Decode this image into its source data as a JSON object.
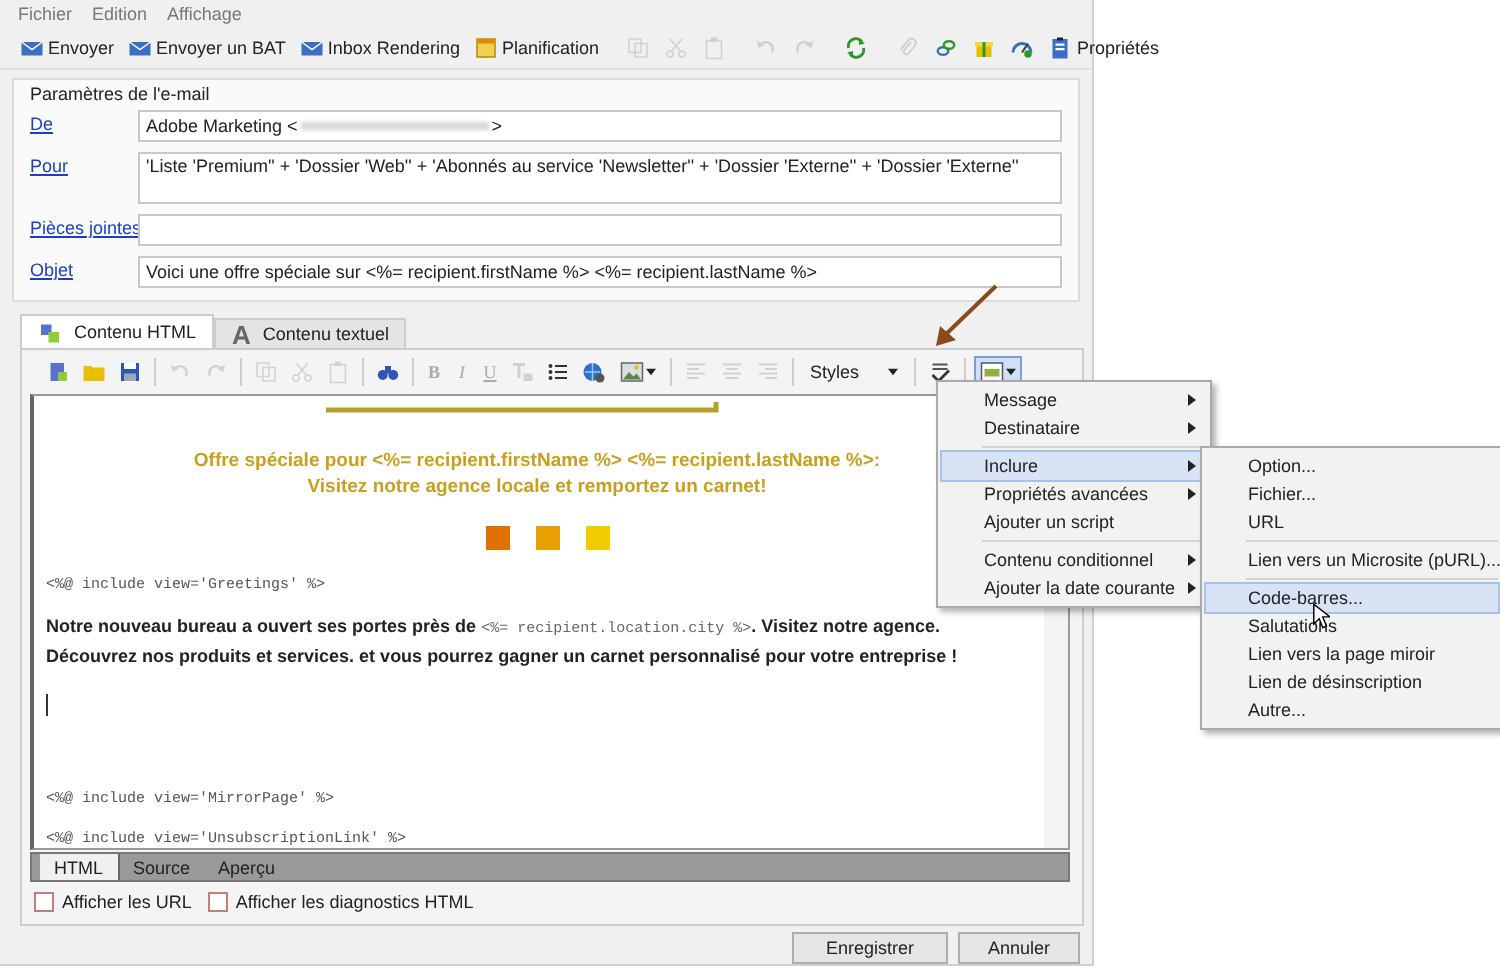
{
  "menu_bar": [
    {
      "label": "Fichier"
    },
    {
      "label": "Edition"
    },
    {
      "label": "Affichage"
    }
  ],
  "toolbar": [
    {
      "kind": "button",
      "label": "Envoyer",
      "disabled": false
    },
    {
      "kind": "button",
      "label": "Envoyer un BAT",
      "disabled": false
    },
    {
      "kind": "button",
      "label": "Inbox Rendering",
      "disabled": false
    },
    {
      "kind": "button",
      "label": "Planification",
      "disabled": false
    },
    {
      "kind": "separator"
    },
    {
      "kind": "icon",
      "disabled": true
    },
    {
      "kind": "icon",
      "disabled": true
    },
    {
      "kind": "icon",
      "disabled": true
    },
    {
      "kind": "separator"
    },
    {
      "kind": "icon",
      "disabled": true
    },
    {
      "kind": "icon",
      "disabled": true
    },
    {
      "kind": "separator"
    },
    {
      "kind": "icon",
      "disabled": false
    },
    {
      "kind": "separator"
    },
    {
      "kind": "icon",
      "disabled": true
    },
    {
      "kind": "icon",
      "disabled": false
    },
    {
      "kind": "icon",
      "disabled": false
    },
    {
      "kind": "icon",
      "disabled": false
    },
    {
      "kind": "button",
      "label": "Propriétés",
      "disabled": false
    }
  ],
  "email_params": {
    "title": "Paramètres de l'e-mail",
    "fields": [
      {
        "kind": "single",
        "label": "De",
        "value": "Adobe Marketing <",
        "value_end": ">"
      },
      {
        "kind": "multi",
        "label": "Pour",
        "value": "'Liste 'Premium'' + 'Dossier 'Web'' + 'Abonnés au service 'Newsletter'' + 'Dossier 'Externe'' + 'Dossier 'Externe''"
      },
      {
        "kind": "single",
        "label": "Pièces jointes"
      },
      {
        "kind": "single",
        "label": "Objet",
        "value": "Voici une offre spéciale sur <%= recipient.firstName %> <%= recipient.lastName %>"
      }
    ]
  },
  "content_tabs": [
    {
      "label": "Contenu HTML",
      "selected": true
    },
    {
      "label": "Contenu textuel",
      "glyph": "A",
      "selected": false
    }
  ],
  "editor_toolbar": [
    {
      "kind": "icon",
      "disabled": false
    },
    {
      "kind": "icon",
      "disabled": false
    },
    {
      "kind": "icon",
      "disabled": false
    },
    {
      "kind": "separator"
    },
    {
      "kind": "icon",
      "disabled": true
    },
    {
      "kind": "icon",
      "disabled": true
    },
    {
      "kind": "separator"
    },
    {
      "kind": "icon",
      "disabled": true
    },
    {
      "kind": "icon",
      "disabled": true
    },
    {
      "kind": "icon",
      "disabled": true
    },
    {
      "kind": "separator"
    },
    {
      "kind": "icon",
      "disabled": false
    },
    {
      "kind": "separator"
    },
    {
      "kind": "letter",
      "label": "B",
      "disabled": true
    },
    {
      "kind": "letter",
      "label": "I",
      "disabled": true
    },
    {
      "kind": "letter",
      "label": "U",
      "disabled": true
    },
    {
      "kind": "icon",
      "disabled": true
    },
    {
      "kind": "icon",
      "disabled": false
    },
    {
      "kind": "icon",
      "disabled": false
    },
    {
      "kind": "dropdown",
      "disabled": false,
      "pressed": false
    },
    {
      "kind": "separator"
    },
    {
      "kind": "icon",
      "disabled": true
    },
    {
      "kind": "icon",
      "disabled": true
    },
    {
      "kind": "icon",
      "disabled": true
    },
    {
      "kind": "separator"
    },
    {
      "kind": "select",
      "label": "Styles",
      "disabled": false
    },
    {
      "kind": "separator"
    },
    {
      "kind": "icon",
      "disabled": false
    },
    {
      "kind": "separator"
    },
    {
      "kind": "dropdown",
      "disabled": false,
      "pressed": true
    }
  ],
  "content": {
    "heading": [
      "Offre spéciale pour <%= recipient.firstName %> <%= recipient.lastName %>:",
      "Visitez notre agence locale et remportez un carnet!"
    ],
    "squares": [
      {
        "color": "#e07000"
      },
      {
        "color": "#e8a000"
      },
      {
        "color": "#f0cc00"
      }
    ],
    "blocks": [
      {
        "kind": "code",
        "text": "<%@ include view='Greetings' %>"
      },
      {
        "kind": "paragraph",
        "before": "Notre nouveau bureau a ouvert ses portes près de ",
        "code": "<%= recipient.location.city %>",
        "after": ". Visitez notre agence. Découvrez nos produits et services. et vous pourrez gagner un carnet personnalisé pour votre entreprise !"
      },
      {
        "kind": "cursor"
      },
      {
        "kind": "code",
        "text": "<%@ include view='MirrorPage' %>"
      },
      {
        "kind": "code",
        "text": "<%@ include view='UnsubscriptionLink' %>"
      }
    ]
  },
  "view_tabs": [
    {
      "label": "HTML",
      "selected": true
    },
    {
      "label": "Source",
      "selected": false
    },
    {
      "label": "Aperçu",
      "selected": false
    }
  ],
  "options": [
    {
      "label": "Afficher les URL",
      "checked": false
    },
    {
      "label": "Afficher les diagnostics HTML",
      "checked": false
    }
  ],
  "buttons": [
    {
      "label": "Enregistrer"
    },
    {
      "label": "Annuler"
    }
  ],
  "context_menu": {
    "groups": [
      [
        {
          "label": "Message",
          "submenu": true,
          "selected": false
        },
        {
          "label": "Destinataire",
          "submenu": true,
          "selected": false
        }
      ],
      [
        {
          "label": "Inclure",
          "submenu": true,
          "selected": true
        },
        {
          "label": "Propriétés avancées",
          "submenu": true,
          "selected": false
        },
        {
          "label": "Ajouter un script",
          "submenu": false,
          "selected": false
        }
      ],
      [
        {
          "label": "Contenu conditionnel",
          "submenu": true,
          "selected": false
        },
        {
          "label": "Ajouter la date courante",
          "submenu": true,
          "selected": false
        }
      ]
    ]
  },
  "submenu": {
    "groups": [
      [
        {
          "label": "Option...",
          "selected": false
        },
        {
          "label": "Fichier...",
          "selected": false
        },
        {
          "label": "URL",
          "selected": false
        }
      ],
      [
        {
          "label": "Lien vers un Microsite (pURL)...",
          "selected": false
        }
      ],
      [
        {
          "label": "Code-barres...",
          "selected": true
        },
        {
          "label": "Salutations",
          "selected": false
        },
        {
          "label": "Lien vers la page miroir",
          "selected": false
        },
        {
          "label": "Lien de désinscription",
          "selected": false
        },
        {
          "label": "Autre...",
          "selected": false
        }
      ]
    ]
  }
}
